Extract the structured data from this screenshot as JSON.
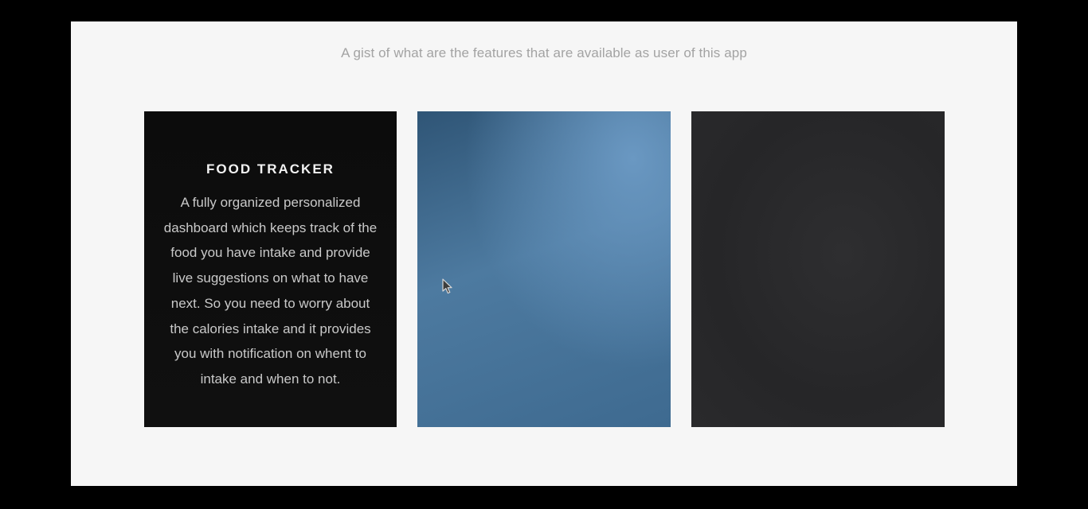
{
  "section": {
    "subtitle": "A gist of what are the features that are available as user of this app"
  },
  "cards": [
    {
      "title": "FOOD TRACKER",
      "description": "A fully organized personalized dashboard which keeps track of the food you have intake and provide live suggestions on what to have next. So you need to worry about the calories intake and it provides you with notification on whent to intake and when to not."
    },
    {
      "title": "",
      "description": ""
    },
    {
      "title": "",
      "description": ""
    }
  ],
  "colors": {
    "page_background": "#f6f6f6",
    "frame_background": "#000000",
    "card1_background": "#0e0e0e",
    "card2_background": "#4d7aa0",
    "card3_background": "#2a2a2c",
    "subtitle_text": "#a3a3a3"
  },
  "icons": {
    "cursor": "mouse-pointer-icon"
  }
}
